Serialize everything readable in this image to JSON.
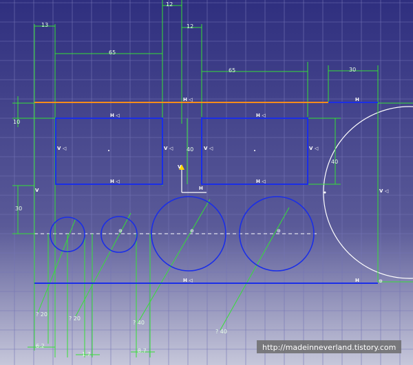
{
  "colors": {
    "bg_top": "#2f2f7f",
    "bg_mid": "#5a5a98",
    "bg_bottom": "#c6c7da",
    "grid": "#7575b5",
    "profile": "#1a2ee8",
    "dimension": "#35e035",
    "construction": "#ffffff",
    "highlight": "#ff8c1a",
    "watermark_bg": "#6d6d6d"
  },
  "dimensions": {
    "top_12_upper": "12",
    "left_13": "13",
    "top_12_lower": "12",
    "left_65": "65",
    "right_65": "65",
    "right_30": "30",
    "left_10": "10",
    "center_40": "40",
    "right_40": "40",
    "left_30": "30",
    "dia_1": "? 20",
    "dia_2": "? 20",
    "dia_3": "? 40",
    "dia_4": "? 40",
    "bottom_1": "6.2",
    "bottom_2": "1 7",
    "bottom_3": "8.7"
  },
  "constraints": {
    "top_h": "H ◁",
    "rect1_top_h": "H ◁",
    "rect2_top_h": "H ◁",
    "rect1_left_v": "V ◁",
    "rect1_right_v": "V ◁",
    "rect2_left_v": "V ◁",
    "rect2_right_v": "V ◁",
    "rect1_bottom_h": "H ◁",
    "rect2_bottom_h": "H ◁",
    "bottom_h": "H ◁",
    "left_v": "V",
    "right_v": "V ◁",
    "axis_h": "H",
    "axis_v": "V",
    "top_right_h": "H",
    "bottom_right_h": "H",
    "circle_center_mark": "⊙"
  },
  "watermark": {
    "text": "http://madeinneverland.tistory.com"
  }
}
